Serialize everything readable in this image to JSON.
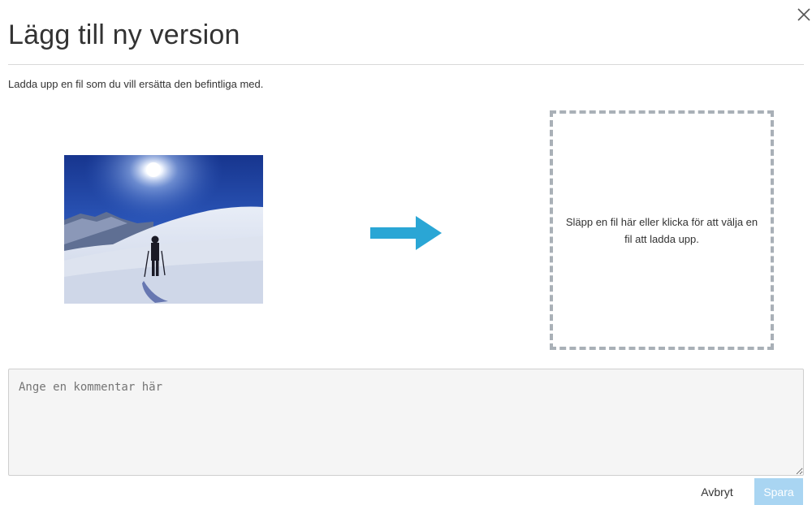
{
  "dialog": {
    "title": "Lägg till ny version",
    "close_icon": "close-icon",
    "instructions": "Ladda upp en fil som du vill ersätta den befintliga med."
  },
  "current_file": {
    "image_description_icon": "image-thumbnail",
    "arrow_icon": "arrow-right-icon",
    "arrow_color": "#2aa6d5"
  },
  "dropzone": {
    "text": "Släpp en fil här eller klicka för att välja en fil att ladda upp.",
    "border_color": "#a9b0b7"
  },
  "comment": {
    "value": "",
    "placeholder": "Ange en kommentar här"
  },
  "actions": {
    "cancel_label": "Avbryt",
    "save_label": "Spara",
    "save_color": "#a9d5f2",
    "save_enabled": false
  }
}
